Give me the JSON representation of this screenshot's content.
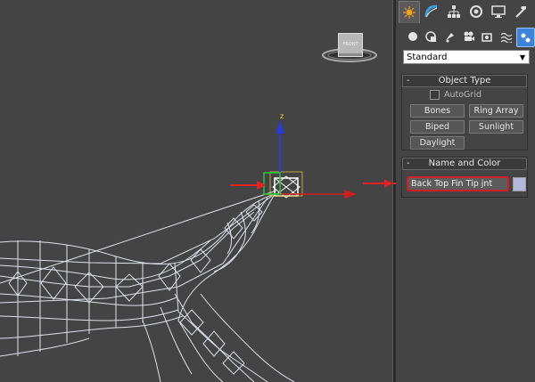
{
  "viewport": {
    "viewcube_label": "FRONT",
    "gizmo_axis_label": "z",
    "background_color": "#444444",
    "wireframe_color": "#dfe2ea",
    "annotation_arrow_color": "#e32124"
  },
  "command_panel": {
    "tabs": [
      "create-icon",
      "modify-icon",
      "hierarchy-icon",
      "motion-icon",
      "display-icon",
      "utilities-icon"
    ],
    "categories": [
      "geometry-icon",
      "shapes-icon",
      "lights-icon",
      "cameras-icon",
      "helpers-icon",
      "spacewarps-icon",
      "systems-icon"
    ],
    "dropdown_value": "Standard",
    "object_type": {
      "title": "Object Type",
      "collapse_symbol": "-",
      "autogrid_label": "AutoGrid",
      "buttons": [
        "Bones",
        "Ring Array",
        "Biped",
        "Sunlight",
        "Daylight"
      ]
    },
    "name_and_color": {
      "title": "Name and Color",
      "collapse_symbol": "-",
      "name_value": "Back Top Fin Tip jnt",
      "color_swatch": "#b4b7d7"
    }
  }
}
